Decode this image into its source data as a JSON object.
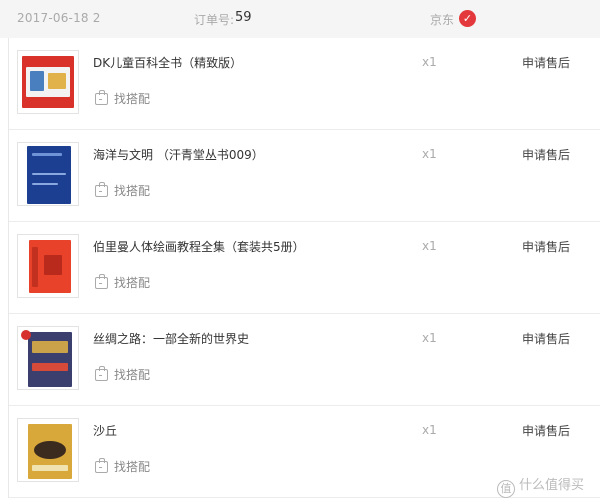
{
  "header": {
    "date": "2017-06-18 2",
    "order_label": "订单号:",
    "order_number": "59",
    "shop": "京东",
    "shop_logo_icon": "jd-logo-icon"
  },
  "items": [
    {
      "title": "DK儿童百科全书（精致版）",
      "match_label": "找搭配",
      "quantity": "x1",
      "action": "申请售后",
      "cover_color": "#d8322b"
    },
    {
      "title": "海洋与文明 （汗青堂丛书009）",
      "match_label": "找搭配",
      "quantity": "x1",
      "action": "申请售后",
      "cover_color": "#1d3f91"
    },
    {
      "title": "伯里曼人体绘画教程全集（套装共5册）",
      "match_label": "找搭配",
      "quantity": "x1",
      "action": "申请售后",
      "cover_color": "#e8432a"
    },
    {
      "title": "丝绸之路：一部全新的世界史",
      "match_label": "找搭配",
      "quantity": "x1",
      "action": "申请售后",
      "cover_color": "#3a3f6e"
    },
    {
      "title": "沙丘",
      "match_label": "找搭配",
      "quantity": "x1",
      "action": "申请售后",
      "cover_color": "#d9a83a"
    }
  ],
  "watermark": {
    "logo_text": "值",
    "text": "什么值得买"
  }
}
